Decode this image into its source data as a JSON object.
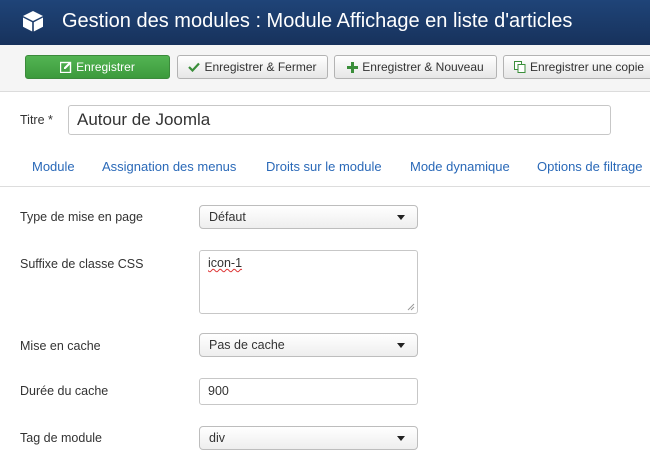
{
  "header": {
    "title": "Gestion des modules : Module Affichage en liste d'articles",
    "icon": "cube-icon"
  },
  "toolbar": {
    "save_label": "Enregistrer",
    "save_close_label": "Enregistrer & Fermer",
    "save_new_label": "Enregistrer & Nouveau",
    "save_copy_label": "Enregistrer une copie",
    "save_color": "#46a546"
  },
  "form": {
    "title_label": "Titre *",
    "title_value": "Autour de Joomla"
  },
  "tabs": [
    {
      "label": "Module"
    },
    {
      "label": "Assignation des menus"
    },
    {
      "label": "Droits sur le module"
    },
    {
      "label": "Mode dynamique"
    },
    {
      "label": "Options de filtrage"
    }
  ],
  "fields": {
    "layout": {
      "label": "Type de mise en page",
      "value": "Défaut"
    },
    "css_suffix": {
      "label": "Suffixe de classe CSS",
      "value": "icon-1"
    },
    "caching": {
      "label": "Mise en cache",
      "value": "Pas de cache"
    },
    "cache_time": {
      "label": "Durée du cache",
      "value": "900"
    },
    "module_tag": {
      "label": "Tag de module",
      "value": "div"
    }
  },
  "colors": {
    "header_bg": "#1a3867",
    "link": "#2a69b8"
  }
}
